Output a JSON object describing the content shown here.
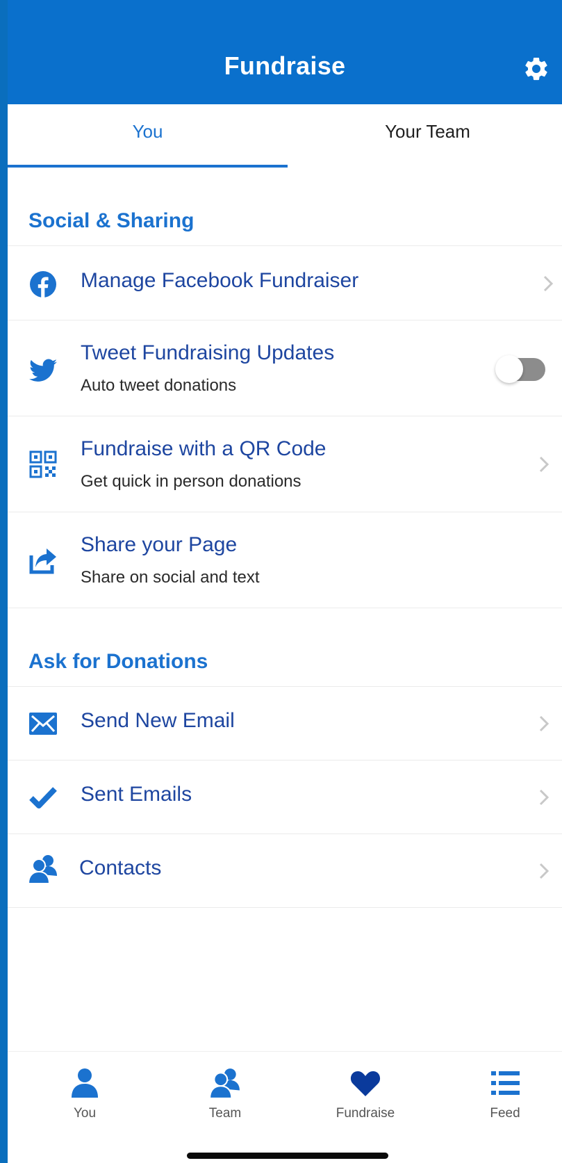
{
  "header": {
    "title": "Fundraise",
    "settings_icon": "gear-icon"
  },
  "tabs": [
    {
      "label": "You",
      "selected": true
    },
    {
      "label": "Your Team",
      "selected": false
    }
  ],
  "sections": {
    "social": {
      "title": "Social & Sharing",
      "items": [
        {
          "icon": "facebook-icon",
          "title": "Manage Facebook Fundraiser"
        },
        {
          "icon": "twitter-icon",
          "title": "Tweet Fundraising Updates",
          "subtitle": "Auto tweet donations",
          "toggle_on": false
        },
        {
          "icon": "qr-code-icon",
          "title": "Fundraise with a QR Code",
          "subtitle": "Get quick in person donations"
        },
        {
          "icon": "share-icon",
          "title": "Share your Page",
          "subtitle": "Share on social and text"
        }
      ]
    },
    "ask": {
      "title": "Ask for Donations",
      "items": [
        {
          "icon": "email-icon",
          "title": "Send New Email"
        },
        {
          "icon": "checkmark-icon",
          "title": "Sent Emails"
        },
        {
          "icon": "contacts-icon",
          "title": "Contacts"
        }
      ]
    }
  },
  "bottom_nav": [
    {
      "icon": "person-icon",
      "label": "You"
    },
    {
      "icon": "team-icon",
      "label": "Team"
    },
    {
      "icon": "heart-icon",
      "label": "Fundraise",
      "active": true
    },
    {
      "icon": "list-icon",
      "label": "Feed"
    }
  ],
  "colors": {
    "primary": "#0a70cc",
    "accent_text": "#1b72cf",
    "item_text": "#1e46a0",
    "active_nav": "#0a3a9c"
  }
}
